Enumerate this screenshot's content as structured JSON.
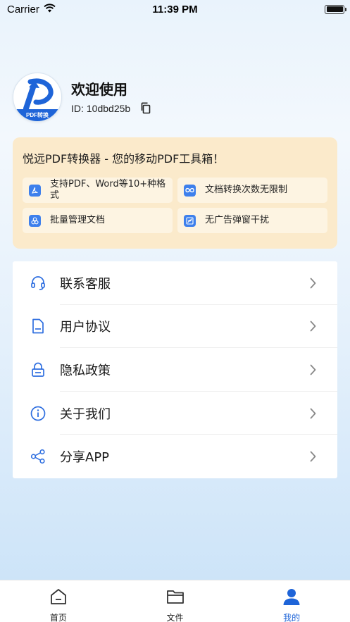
{
  "status_bar": {
    "carrier": "Carrier",
    "time": "11:39 PM"
  },
  "profile": {
    "avatar_caption": "PDF转换",
    "welcome": "欢迎使用",
    "id_label": "ID:",
    "id_value": "10dbd25b"
  },
  "promo": {
    "title": "悦远PDF转换器 - 您的移动PDF工具箱！",
    "features": [
      {
        "icon": "pdf-icon",
        "label": "支持PDF、Word等10+种格式"
      },
      {
        "icon": "infinity-icon",
        "label": "文档转换次数无限制"
      },
      {
        "icon": "batch-icon",
        "label": "批量管理文档"
      },
      {
        "icon": "no-ads-icon",
        "label": "无广告弹窗干扰"
      }
    ]
  },
  "menu": {
    "items": [
      {
        "icon": "headset-icon",
        "label": "联系客服"
      },
      {
        "icon": "document-icon",
        "label": "用户协议"
      },
      {
        "icon": "lock-icon",
        "label": "隐私政策"
      },
      {
        "icon": "info-icon",
        "label": "关于我们"
      },
      {
        "icon": "share-icon",
        "label": "分享APP"
      }
    ]
  },
  "tab_bar": {
    "tabs": [
      {
        "icon": "home-icon",
        "label": "首页"
      },
      {
        "icon": "folder-icon",
        "label": "文件"
      },
      {
        "icon": "user-icon",
        "label": "我的"
      }
    ],
    "active_index": 2
  },
  "colors": {
    "accent": "#1e64d8",
    "icon_blue": "#3e80ec",
    "promo_bg": "#fbeacb",
    "feature_bg": "#fdf4e2"
  }
}
